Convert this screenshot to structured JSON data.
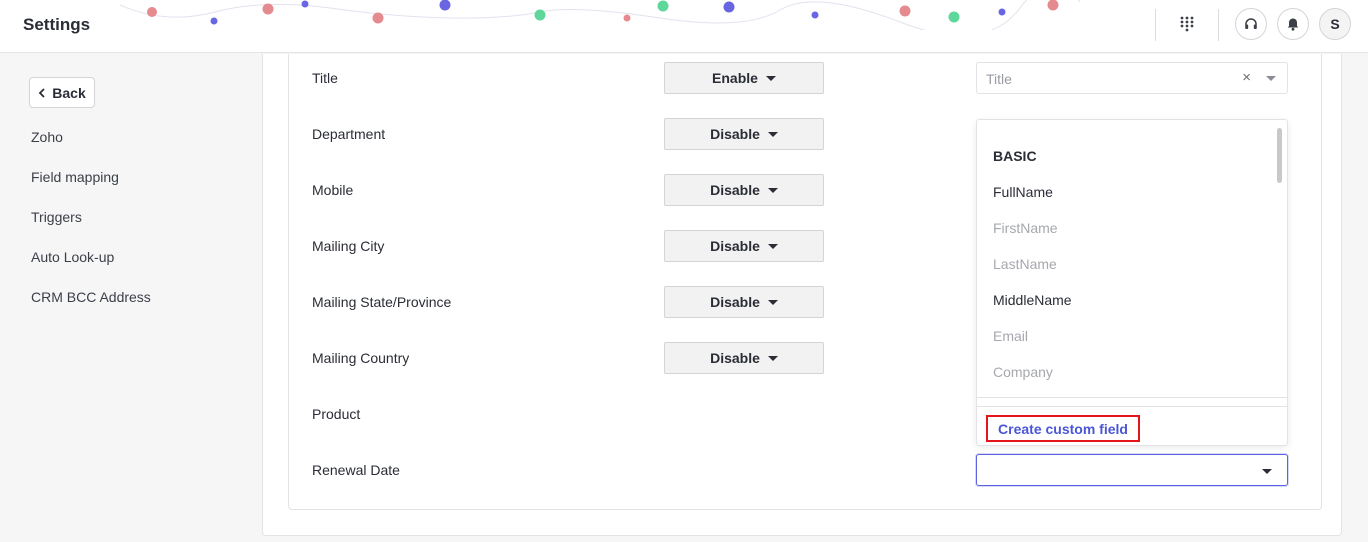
{
  "header": {
    "title": "Settings",
    "avatar_initial": "S"
  },
  "sidebar": {
    "back_label": "Back",
    "items": [
      {
        "label": "Zoho"
      },
      {
        "label": "Field mapping"
      },
      {
        "label": "Triggers"
      },
      {
        "label": "Auto Look-up"
      },
      {
        "label": "CRM BCC Address"
      }
    ]
  },
  "rows": [
    {
      "label": "Title",
      "toggle": "Enable"
    },
    {
      "label": "Department",
      "toggle": "Disable"
    },
    {
      "label": "Mobile",
      "toggle": "Disable"
    },
    {
      "label": "Mailing City",
      "toggle": "Disable"
    },
    {
      "label": "Mailing State/Province",
      "toggle": "Disable"
    },
    {
      "label": "Mailing Country",
      "toggle": "Disable"
    },
    {
      "label": "Product",
      "toggle": ""
    },
    {
      "label": "Renewal Date",
      "toggle": ""
    }
  ],
  "title_select": {
    "placeholder": "Title",
    "clear": "×"
  },
  "dropdown": {
    "heading": "BASIC",
    "options": [
      {
        "label": "FullName",
        "state": "enabled"
      },
      {
        "label": "FirstName",
        "state": "disabled"
      },
      {
        "label": "LastName",
        "state": "disabled"
      },
      {
        "label": "MiddleName",
        "state": "enabled"
      },
      {
        "label": "Email",
        "state": "disabled"
      },
      {
        "label": "Company",
        "state": "disabled"
      }
    ],
    "create_label": "Create custom field"
  },
  "colors": {
    "accent": "#4a56d6",
    "highlight_border": "#e5141a",
    "garland_red": "#e58b8f",
    "garland_blue": "#6a66e3",
    "garland_green": "#5fd79a"
  },
  "icons": [
    "apps-grid-icon",
    "headset-icon",
    "bell-icon",
    "chevron-left-icon",
    "caret-down-icon",
    "clear-icon"
  ]
}
